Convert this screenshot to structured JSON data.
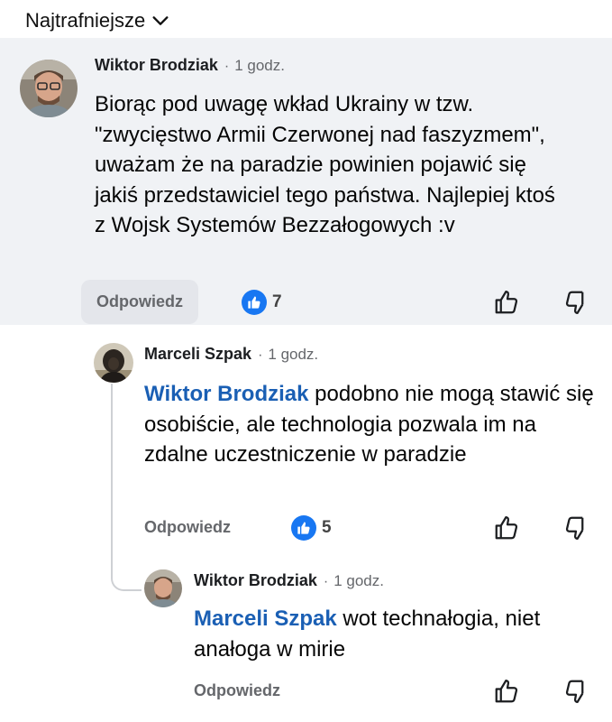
{
  "sort": {
    "label": "Najtrafniejsze"
  },
  "comments": [
    {
      "author": "Wiktor Brodziak",
      "time": "1 godz.",
      "mention": "",
      "text": "Biorąc pod uwagę wkład Ukrainy w tzw. \"zwycięstwo Armii Czerwonej nad faszyzmem\", uważam że na paradzie powinien pojawić się jakiś przedstawiciel tego państwa. Najlepiej ktoś z Wojsk Systemów Bezzałogowych :v",
      "reply_label": "Odpowiedz",
      "likes": "7"
    },
    {
      "author": "Marceli Szpak",
      "time": "1 godz.",
      "mention": "Wiktor Brodziak",
      "text": "podobno nie mogą stawić się osobiście, ale technologia pozwala im na zdalne uczestniczenie w paradzie",
      "reply_label": "Odpowiedz",
      "likes": "5"
    },
    {
      "author": "Wiktor Brodziak",
      "time": "1 godz.",
      "mention": "Marceli Szpak",
      "text": "wot technałogia, niet anałoga w mirie",
      "reply_label": "Odpowiedz",
      "likes": ""
    }
  ],
  "separator": "·",
  "icons": {
    "sort": "chevron-down-icon",
    "reaction": "thumbs-up-icon",
    "upvote": "thumbs-up-outline-icon",
    "downvote": "thumbs-down-outline-icon"
  },
  "colors": {
    "accent": "#1877f2",
    "mention": "#1a5fb4",
    "highlight_background": "#f0f2f5",
    "secondary_text": "#65676b"
  }
}
